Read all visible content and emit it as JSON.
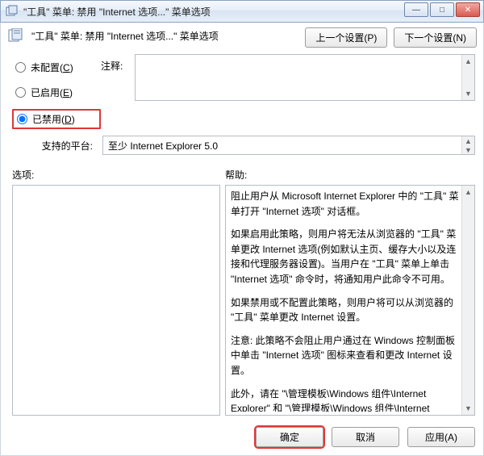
{
  "window": {
    "title": "\"工具\" 菜单: 禁用 \"Internet 选项...\" 菜单选项",
    "header_title": "\"工具\" 菜单: 禁用 \"Internet 选项...\" 菜单选项",
    "min": "—",
    "max": "□",
    "close": "✕"
  },
  "nav": {
    "prev": "上一个设置(P)",
    "next": "下一个设置(N)"
  },
  "radios": {
    "not_configured": {
      "label": "未配置",
      "accel": "C",
      "checked": false
    },
    "enabled": {
      "label": "已启用",
      "accel": "E",
      "checked": false
    },
    "disabled": {
      "label": "已禁用",
      "accel": "D",
      "checked": true
    }
  },
  "comment": {
    "label": "注释:",
    "value": ""
  },
  "platform": {
    "label": "支持的平台:",
    "value": "至少 Internet Explorer 5.0"
  },
  "split": {
    "options_label": "选项:",
    "help_label": "帮助:"
  },
  "help": {
    "p1": "阻止用户从 Microsoft Internet Explorer 中的 \"工具\" 菜单打开 \"Internet 选项\" 对话框。",
    "p2": "如果启用此策略，则用户将无法从浏览器的 \"工具\" 菜单更改 Internet 选项(例如默认主页、缓存大小以及连接和代理服务器设置)。当用户在 \"工具\" 菜单上单击 \"Internet 选项\" 命令时，将通知用户此命令不可用。",
    "p3": "如果禁用或不配置此策略，则用户将可以从浏览器的 \"工具\" 菜单更改 Internet 设置。",
    "p4": "注意: 此策略不会阻止用户通过在 Windows 控制面板中单击 \"Internet 选项\" 图标来查看和更改 Internet 设置。",
    "p5": "此外，请在 \"\\管理模板\\Windows 组件\\Internet Explorer\" 和 \"\\管理模板\\Windows 组件\\Internet Explorer\\Internet 控制面板文件夹\" 中查看 Internet 选项的策略。"
  },
  "footer": {
    "ok": "确定",
    "cancel": "取消",
    "apply": "应用(A)"
  }
}
